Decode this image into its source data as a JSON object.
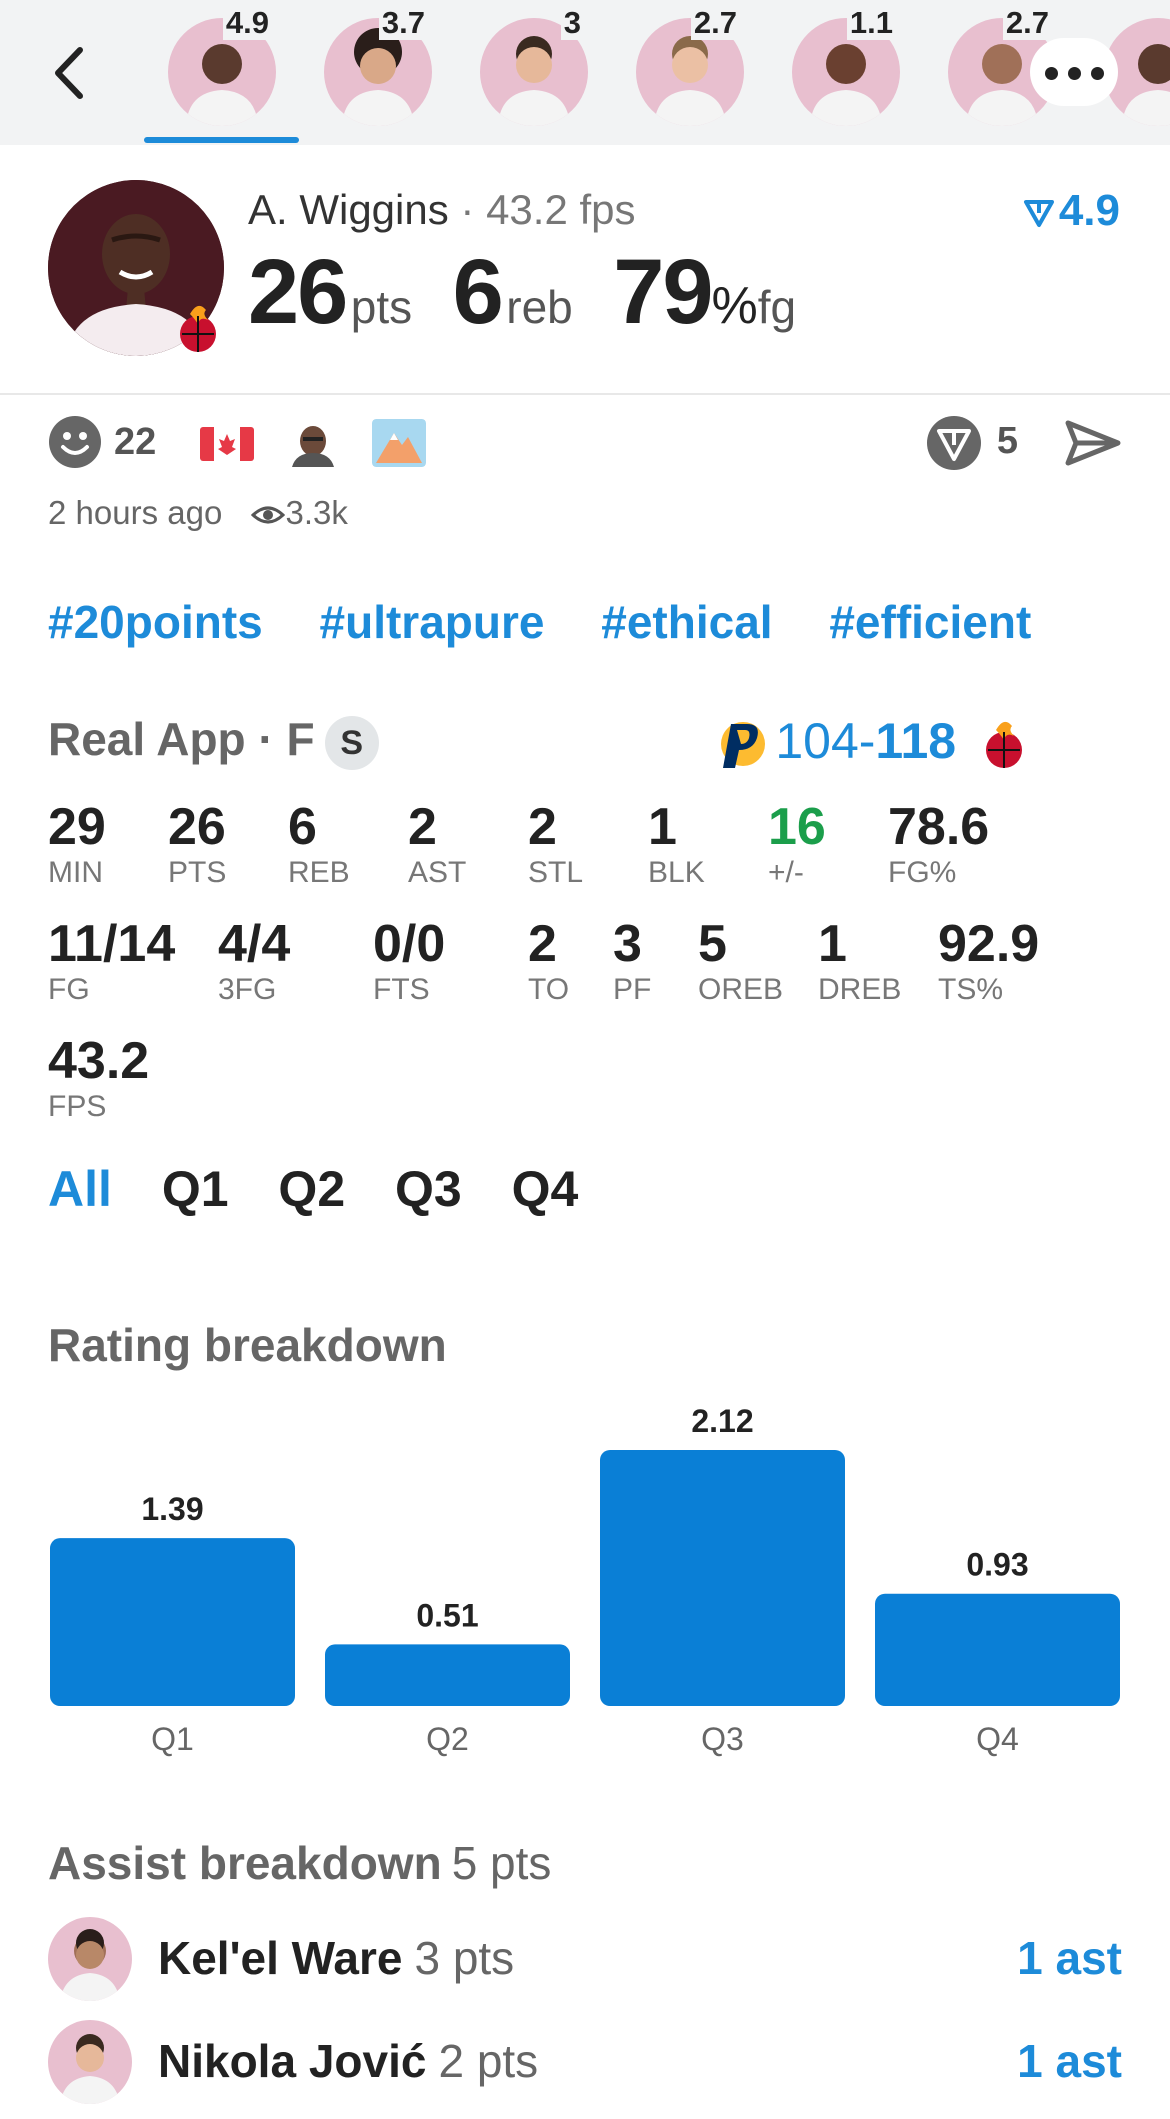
{
  "top_bar": {
    "players": [
      {
        "rating": "4.9"
      },
      {
        "rating": "3.7"
      },
      {
        "rating": "3"
      },
      {
        "rating": "2.7"
      },
      {
        "rating": "1.1"
      },
      {
        "rating": "2.7"
      }
    ]
  },
  "player": {
    "name": "A. Wiggins",
    "fps": "43.2 fps",
    "rating": "4.9",
    "pts": "26",
    "pts_label": "pts",
    "reb": "6",
    "reb_label": "reb",
    "fg": "79",
    "fg_pct": "%",
    "fg_label": "fg"
  },
  "reactions": {
    "count": "22",
    "share_count": "5",
    "time_ago": "2 hours ago",
    "views": "3.3k"
  },
  "hashtags": [
    "#20points",
    "#ultrapure",
    "#ethical",
    "#efficient"
  ],
  "game": {
    "source": "Real App",
    "position": "F",
    "badge": "S",
    "score_away": "104",
    "score_sep": "-",
    "score_home": "118"
  },
  "stats_row1": [
    {
      "v": "29",
      "l": "MIN"
    },
    {
      "v": "26",
      "l": "PTS"
    },
    {
      "v": "6",
      "l": "REB"
    },
    {
      "v": "2",
      "l": "AST"
    },
    {
      "v": "2",
      "l": "STL"
    },
    {
      "v": "1",
      "l": "BLK"
    },
    {
      "v": "16",
      "l": "+/-"
    },
    {
      "v": "78.6",
      "l": "FG%"
    }
  ],
  "stats_row2": [
    {
      "v": "11/14",
      "l": "FG"
    },
    {
      "v": "4/4",
      "l": "3FG"
    },
    {
      "v": "0/0",
      "l": "FTS"
    },
    {
      "v": "2",
      "l": "TO"
    },
    {
      "v": "3",
      "l": "PF"
    },
    {
      "v": "5",
      "l": "OREB"
    },
    {
      "v": "1",
      "l": "DREB"
    },
    {
      "v": "92.9",
      "l": "TS%"
    }
  ],
  "stats_row3": [
    {
      "v": "43.2",
      "l": "FPS"
    }
  ],
  "quarter_tabs": [
    "All",
    "Q1",
    "Q2",
    "Q3",
    "Q4"
  ],
  "rating_breakdown": {
    "title": "Rating breakdown"
  },
  "chart_data": {
    "type": "bar",
    "categories": [
      "Q1",
      "Q2",
      "Q3",
      "Q4"
    ],
    "values": [
      1.39,
      0.51,
      2.12,
      0.93
    ],
    "value_labels": [
      "1.39",
      "0.51",
      "2.12",
      "0.93"
    ],
    "title": "",
    "xlabel": "",
    "ylabel": "",
    "ylim": [
      0,
      2.12
    ],
    "grid": false,
    "color": "#0a7fd6"
  },
  "assist_breakdown": {
    "title": "Assist breakdown",
    "total": "5 pts",
    "rows": [
      {
        "name": "Kel'el Ware",
        "pts": "3 pts",
        "ast": "1 ast"
      },
      {
        "name": "Nikola Jović",
        "pts": "2 pts",
        "ast": "1 ast"
      }
    ]
  },
  "colors": {
    "accent": "#1d8bd9",
    "bar": "#0a7fd6",
    "positive": "#1b9e4b",
    "heat_red": "#c8102e",
    "pacers_navy": "#002d62",
    "pacers_gold": "#fdbb30"
  },
  "icons": {
    "back": "chevron-left-icon",
    "more": "more-icon",
    "rating": "rating-arrow-icon",
    "smile": "smile-icon",
    "flag": "canada-flag-icon",
    "views": "eye-icon",
    "share": "send-icon"
  }
}
